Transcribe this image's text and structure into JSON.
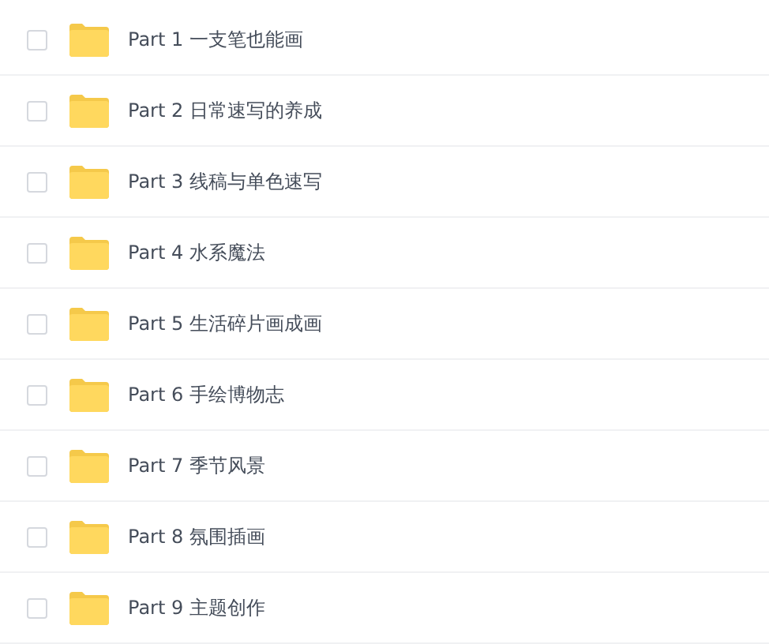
{
  "files": [
    {
      "name": "Part 1 一支笔也能画",
      "checked": false
    },
    {
      "name": "Part 2 日常速写的养成",
      "checked": false
    },
    {
      "name": "Part 3 线稿与单色速写",
      "checked": false
    },
    {
      "name": "Part 4 水系魔法",
      "checked": false
    },
    {
      "name": "Part 5 生活碎片画成画",
      "checked": false
    },
    {
      "name": "Part 6 手绘博物志",
      "checked": false
    },
    {
      "name": "Part 7 季节风景",
      "checked": false
    },
    {
      "name": "Part 8 氛围插画",
      "checked": false
    },
    {
      "name": "Part 9 主题创作",
      "checked": false
    }
  ]
}
